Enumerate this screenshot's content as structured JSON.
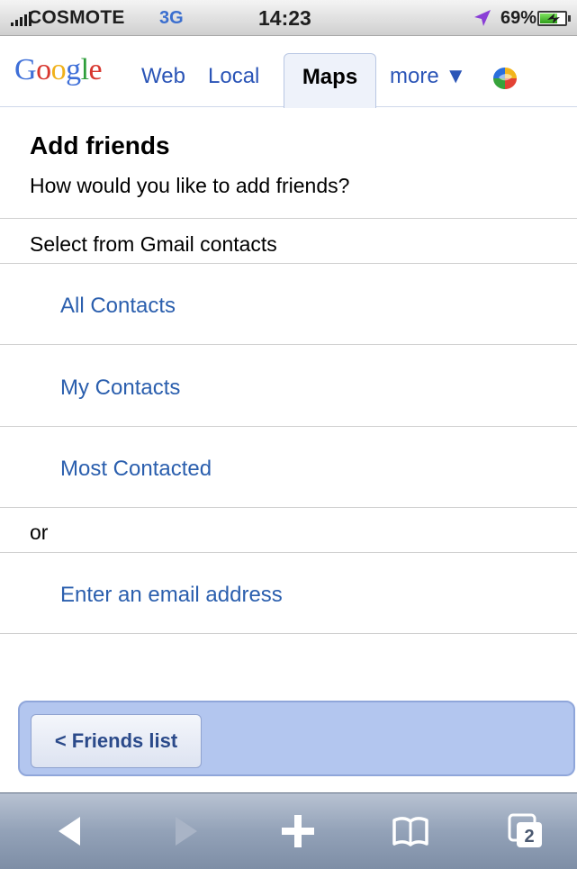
{
  "status_bar": {
    "carrier": "COSMOTE",
    "network": "3G",
    "time": "14:23",
    "battery_percent_label": "69%",
    "battery_level": 0.69,
    "icons": [
      "signal-bars-icon",
      "location-arrow-icon",
      "battery-charging-icon"
    ]
  },
  "nav": {
    "logo": "Google",
    "links": [
      "Web",
      "Local"
    ],
    "active_tab": "Maps",
    "more_label": "more ▼",
    "latitude_icon": "latitude-icon"
  },
  "page": {
    "title": "Add friends",
    "subtitle": "How would you like to add friends?"
  },
  "gmail_section": {
    "label": "Select from Gmail contacts",
    "options": [
      "All Contacts",
      "My Contacts",
      "Most Contacted"
    ]
  },
  "or_section": {
    "label": "or",
    "options": [
      "Enter an email address"
    ]
  },
  "footer": {
    "back_button_label": "< Friends list"
  },
  "toolbar": {
    "tabs_count": "2",
    "icons": [
      "back-icon",
      "forward-icon",
      "add-bookmark-icon",
      "bookmarks-icon",
      "pages-icon"
    ]
  },
  "colors": {
    "link": "#2b5fae",
    "nav_link": "#2b55b7",
    "footer_bar": "#b3c6ef"
  }
}
